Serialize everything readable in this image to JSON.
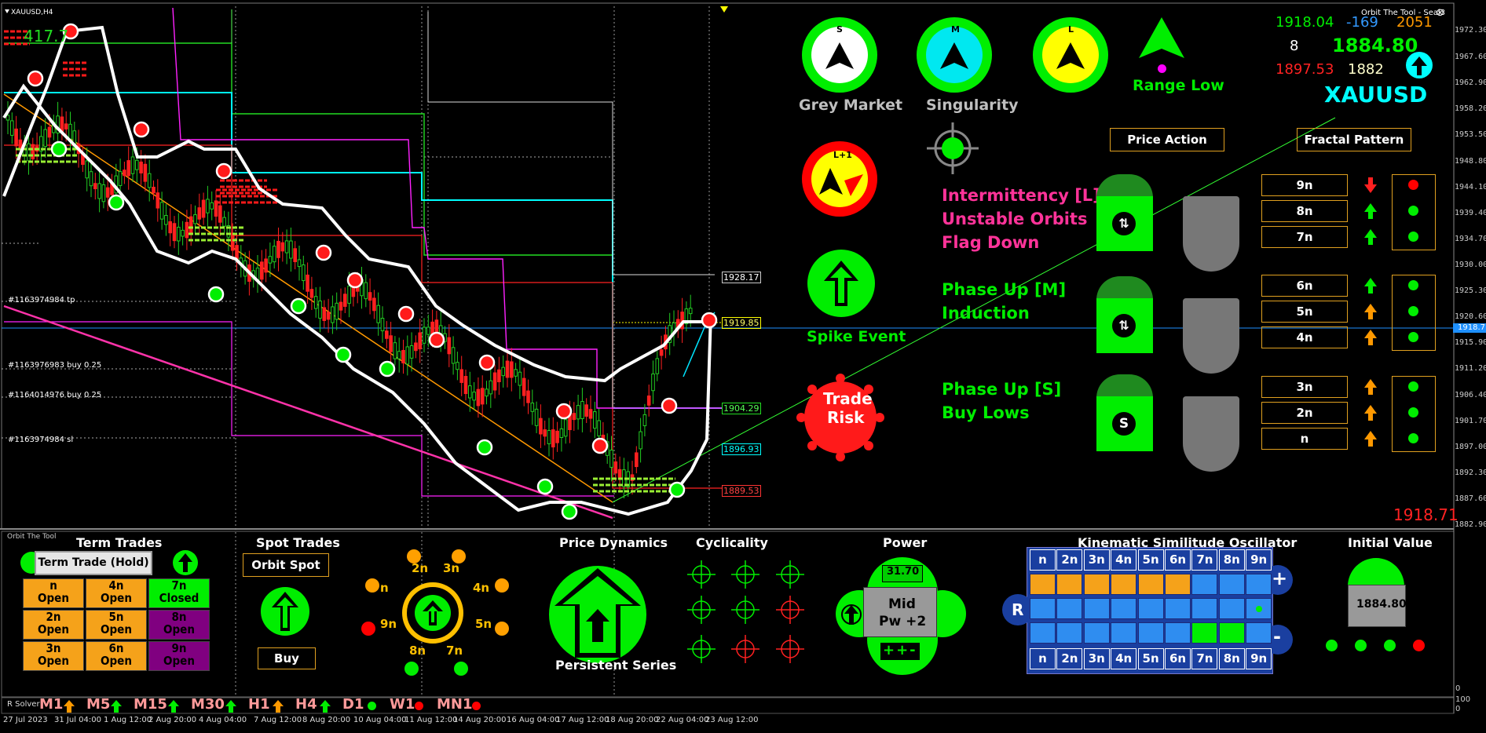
{
  "window": {
    "title": "XAUUSD,H4",
    "brand": "Orbit The Tool - Seal3",
    "close_glyph": "⊗"
  },
  "overlays": {
    "top_left_number": "417.7",
    "orders": [
      "#1163974984 tp",
      "#1163976983 buy 0.25",
      "#1164014976 buy 0.25",
      "#1163974984 sl"
    ]
  },
  "dials": {
    "grey_market": {
      "letter": "S",
      "label": "Grey Market"
    },
    "singularity": {
      "letter": "M",
      "label": "Singularity"
    },
    "l_dial": {
      "letter": "L"
    },
    "range_low": {
      "label": "Range Low"
    },
    "l1_dial": {
      "letter": "L+1"
    },
    "spike_event": {
      "label": "Spike Event"
    },
    "trade_risk": {
      "line1": "Trade",
      "line2": "Risk"
    }
  },
  "stats": {
    "v1": "1918.04",
    "v2": "-169",
    "v3": "2051",
    "v4": "8",
    "v5": "1884.80",
    "v6": "1897.53",
    "v7": "1882",
    "symbol": "XAUUSD",
    "current_price": "1918.71"
  },
  "buttons": {
    "price_action": "Price Action",
    "fractal_pattern": "Fractal Pattern"
  },
  "messages": {
    "group1": [
      "Intermittency [L]",
      "Unstable Orbits",
      "Flag Down"
    ],
    "group2": [
      "Phase Up [M]",
      "Induction"
    ],
    "group3": [
      "Phase Up [S]",
      "Buy Lows"
    ]
  },
  "fractal": {
    "rows": [
      "9n",
      "8n",
      "7n",
      "6n",
      "5n",
      "4n",
      "3n",
      "2n",
      "n"
    ],
    "arrows": [
      "down",
      "up",
      "up",
      "up",
      "up-orange",
      "up-orange",
      "up-orange",
      "up-orange",
      "up-orange"
    ],
    "dots": [
      "red",
      "green",
      "green",
      "green",
      "green",
      "green",
      "green",
      "green",
      "green"
    ]
  },
  "price_labels": {
    "p1": "1928.17",
    "p2": "1919.85",
    "p3": "1904.29",
    "p4": "1896.93",
    "p5": "1889.53"
  },
  "y_axis": [
    "1972.30",
    "1967.60",
    "1962.90",
    "1958.20",
    "1953.50",
    "1948.80",
    "1944.10",
    "1939.40",
    "1934.70",
    "1930.00",
    "1925.30",
    "1920.60",
    "1918.71",
    "1915.90",
    "1911.20",
    "1906.40",
    "1901.70",
    "1897.00",
    "1892.30",
    "1887.60",
    "1882.90"
  ],
  "x_axis": [
    "27 Jul 2023",
    "31 Jul 04:00",
    "1 Aug 12:00",
    "2 Aug 20:00",
    "4 Aug 04:00",
    "7 Aug 12:00",
    "8 Aug 20:00",
    "10 Aug 04:00",
    "11 Aug 12:00",
    "14 Aug 20:00",
    "16 Aug 04:00",
    "17 Aug 12:00",
    "18 Aug 20:00",
    "22 Aug 04:00",
    "23 Aug 12:00"
  ],
  "lower_axis": [
    "100",
    "0"
  ],
  "panel": {
    "caption": "Orbit The Tool",
    "term_trades": {
      "title": "Term Trades",
      "hold_button": "Term Trade (Hold)",
      "cells": [
        {
          "n": "n",
          "s": "Open",
          "c": "orange"
        },
        {
          "n": "4n",
          "s": "Open",
          "c": "orange"
        },
        {
          "n": "7n",
          "s": "Closed",
          "c": "green"
        },
        {
          "n": "2n",
          "s": "Open",
          "c": "orange"
        },
        {
          "n": "5n",
          "s": "Open",
          "c": "orange"
        },
        {
          "n": "8n",
          "s": "Open",
          "c": "purple"
        },
        {
          "n": "3n",
          "s": "Open",
          "c": "orange"
        },
        {
          "n": "6n",
          "s": "Open",
          "c": "orange"
        },
        {
          "n": "9n",
          "s": "Open",
          "c": "purple"
        }
      ]
    },
    "spot_trades": {
      "title": "Spot Trades",
      "orbit_spot": "Orbit Spot",
      "buy": "Buy"
    },
    "orbit_labels": [
      "2n",
      "3n",
      "4n",
      "5n",
      "7n",
      "8n",
      "9n",
      "n"
    ],
    "price_dynamics": {
      "title": "Price Dynamics",
      "label": "Persistent Series"
    },
    "cyclicality": {
      "title": "Cyclicality"
    },
    "power": {
      "title": "Power",
      "value": "31.70",
      "mid": "Mid",
      "pw": "Pw +2",
      "signs": "++-"
    },
    "kso": {
      "title": "Kinematic Similitude Oscillator",
      "headers": [
        "n",
        "2n",
        "3n",
        "4n",
        "5n",
        "6n",
        "7n",
        "8n",
        "9n"
      ],
      "left_label": "R",
      "plus": "+",
      "minus": "-",
      "rows": [
        [
          "orange",
          "orange",
          "orange",
          "orange",
          "orange",
          "orange",
          "blue",
          "blue",
          "blue"
        ],
        [
          "blue",
          "blue",
          "blue",
          "blue",
          "blue",
          "blue",
          "blue",
          "blue",
          "dot"
        ],
        [
          "blue",
          "blue",
          "blue",
          "blue",
          "blue",
          "blue",
          "green",
          "green",
          "blue"
        ]
      ]
    },
    "initial_value": {
      "title": "Initial Value",
      "value": "1884.80"
    }
  },
  "timeframes": {
    "solver": "R Solver",
    "items": [
      {
        "label": "M1",
        "mark": "up-orange"
      },
      {
        "label": "M5",
        "mark": "up-green"
      },
      {
        "label": "M15",
        "mark": "up-green"
      },
      {
        "label": "M30",
        "mark": "up-green"
      },
      {
        "label": "H1",
        "mark": "up-orange"
      },
      {
        "label": "H4",
        "mark": "up-green"
      },
      {
        "label": "D1",
        "mark": "dot-green"
      },
      {
        "label": "W1",
        "mark": "dot-red"
      },
      {
        "label": "MN1",
        "mark": "dot-red"
      }
    ]
  },
  "colors": {
    "bg": "#000000",
    "green": "#00ff00",
    "cyan": "#00ffff",
    "yellow": "#ffff00",
    "red": "#ff0000",
    "orange": "#ffa000",
    "magenta": "#ff00ff",
    "pink": "#ff3399",
    "purple": "#800080",
    "kso_blue": "#2f8df0"
  }
}
